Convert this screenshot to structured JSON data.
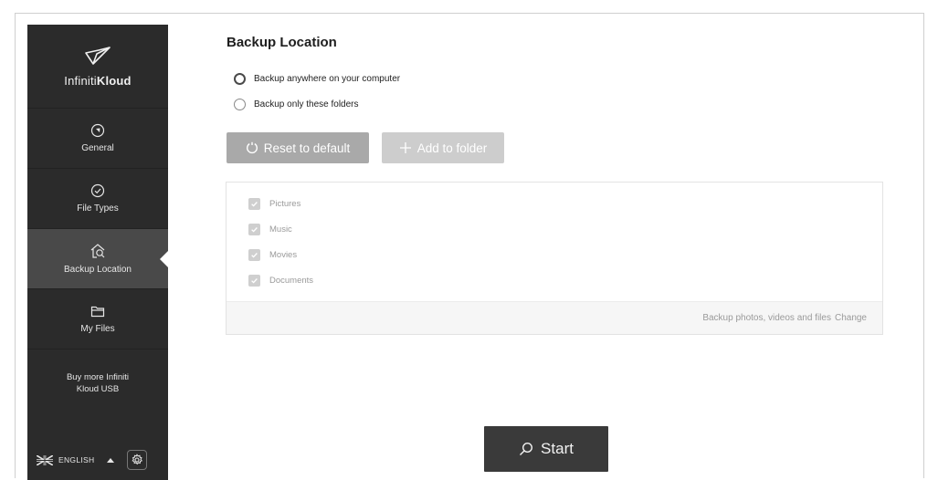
{
  "app": {
    "brand_light": "Infiniti",
    "brand_bold": "Kloud"
  },
  "sidebar": {
    "items": [
      {
        "label": "General",
        "icon": "compass-icon"
      },
      {
        "label": "File Types",
        "icon": "check-circle-icon"
      },
      {
        "label": "Backup Location",
        "icon": "home-search-icon",
        "active": true
      },
      {
        "label": "My Files",
        "icon": "folder-icon"
      }
    ],
    "buy_link": "Buy more Infiniti Kloud USB",
    "language": "ENGLISH"
  },
  "main": {
    "title": "Backup Location",
    "options": [
      {
        "label": "Backup anywhere on your computer",
        "selected": true
      },
      {
        "label": "Backup only these folders",
        "selected": false
      }
    ],
    "reset_label": "Reset to default",
    "add_label": "Add to folder",
    "folders": [
      {
        "label": "Pictures",
        "checked": true
      },
      {
        "label": "Music",
        "checked": true
      },
      {
        "label": "Movies",
        "checked": true
      },
      {
        "label": "Documents",
        "checked": true
      }
    ],
    "footer_text": "Backup photos, videos and files",
    "change_label": "Change",
    "start_label": "Start"
  },
  "colors": {
    "sidebar_bg": "#2b2b2b",
    "sidebar_active": "#494949",
    "start_bg": "#3a3a3a",
    "reset_bg": "#a9a9a9",
    "add_bg": "#cdcdcd"
  }
}
